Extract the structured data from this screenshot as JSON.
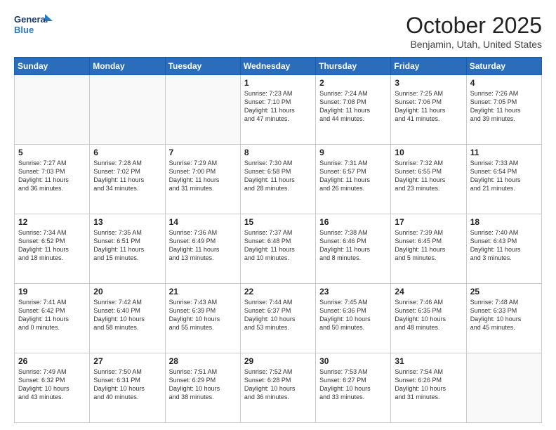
{
  "header": {
    "logo_line1": "General",
    "logo_line2": "Blue",
    "month": "October 2025",
    "location": "Benjamin, Utah, United States"
  },
  "weekdays": [
    "Sunday",
    "Monday",
    "Tuesday",
    "Wednesday",
    "Thursday",
    "Friday",
    "Saturday"
  ],
  "weeks": [
    [
      {
        "day": "",
        "info": ""
      },
      {
        "day": "",
        "info": ""
      },
      {
        "day": "",
        "info": ""
      },
      {
        "day": "1",
        "info": "Sunrise: 7:23 AM\nSunset: 7:10 PM\nDaylight: 11 hours\nand 47 minutes."
      },
      {
        "day": "2",
        "info": "Sunrise: 7:24 AM\nSunset: 7:08 PM\nDaylight: 11 hours\nand 44 minutes."
      },
      {
        "day": "3",
        "info": "Sunrise: 7:25 AM\nSunset: 7:06 PM\nDaylight: 11 hours\nand 41 minutes."
      },
      {
        "day": "4",
        "info": "Sunrise: 7:26 AM\nSunset: 7:05 PM\nDaylight: 11 hours\nand 39 minutes."
      }
    ],
    [
      {
        "day": "5",
        "info": "Sunrise: 7:27 AM\nSunset: 7:03 PM\nDaylight: 11 hours\nand 36 minutes."
      },
      {
        "day": "6",
        "info": "Sunrise: 7:28 AM\nSunset: 7:02 PM\nDaylight: 11 hours\nand 34 minutes."
      },
      {
        "day": "7",
        "info": "Sunrise: 7:29 AM\nSunset: 7:00 PM\nDaylight: 11 hours\nand 31 minutes."
      },
      {
        "day": "8",
        "info": "Sunrise: 7:30 AM\nSunset: 6:58 PM\nDaylight: 11 hours\nand 28 minutes."
      },
      {
        "day": "9",
        "info": "Sunrise: 7:31 AM\nSunset: 6:57 PM\nDaylight: 11 hours\nand 26 minutes."
      },
      {
        "day": "10",
        "info": "Sunrise: 7:32 AM\nSunset: 6:55 PM\nDaylight: 11 hours\nand 23 minutes."
      },
      {
        "day": "11",
        "info": "Sunrise: 7:33 AM\nSunset: 6:54 PM\nDaylight: 11 hours\nand 21 minutes."
      }
    ],
    [
      {
        "day": "12",
        "info": "Sunrise: 7:34 AM\nSunset: 6:52 PM\nDaylight: 11 hours\nand 18 minutes."
      },
      {
        "day": "13",
        "info": "Sunrise: 7:35 AM\nSunset: 6:51 PM\nDaylight: 11 hours\nand 15 minutes."
      },
      {
        "day": "14",
        "info": "Sunrise: 7:36 AM\nSunset: 6:49 PM\nDaylight: 11 hours\nand 13 minutes."
      },
      {
        "day": "15",
        "info": "Sunrise: 7:37 AM\nSunset: 6:48 PM\nDaylight: 11 hours\nand 10 minutes."
      },
      {
        "day": "16",
        "info": "Sunrise: 7:38 AM\nSunset: 6:46 PM\nDaylight: 11 hours\nand 8 minutes."
      },
      {
        "day": "17",
        "info": "Sunrise: 7:39 AM\nSunset: 6:45 PM\nDaylight: 11 hours\nand 5 minutes."
      },
      {
        "day": "18",
        "info": "Sunrise: 7:40 AM\nSunset: 6:43 PM\nDaylight: 11 hours\nand 3 minutes."
      }
    ],
    [
      {
        "day": "19",
        "info": "Sunrise: 7:41 AM\nSunset: 6:42 PM\nDaylight: 11 hours\nand 0 minutes."
      },
      {
        "day": "20",
        "info": "Sunrise: 7:42 AM\nSunset: 6:40 PM\nDaylight: 10 hours\nand 58 minutes."
      },
      {
        "day": "21",
        "info": "Sunrise: 7:43 AM\nSunset: 6:39 PM\nDaylight: 10 hours\nand 55 minutes."
      },
      {
        "day": "22",
        "info": "Sunrise: 7:44 AM\nSunset: 6:37 PM\nDaylight: 10 hours\nand 53 minutes."
      },
      {
        "day": "23",
        "info": "Sunrise: 7:45 AM\nSunset: 6:36 PM\nDaylight: 10 hours\nand 50 minutes."
      },
      {
        "day": "24",
        "info": "Sunrise: 7:46 AM\nSunset: 6:35 PM\nDaylight: 10 hours\nand 48 minutes."
      },
      {
        "day": "25",
        "info": "Sunrise: 7:48 AM\nSunset: 6:33 PM\nDaylight: 10 hours\nand 45 minutes."
      }
    ],
    [
      {
        "day": "26",
        "info": "Sunrise: 7:49 AM\nSunset: 6:32 PM\nDaylight: 10 hours\nand 43 minutes."
      },
      {
        "day": "27",
        "info": "Sunrise: 7:50 AM\nSunset: 6:31 PM\nDaylight: 10 hours\nand 40 minutes."
      },
      {
        "day": "28",
        "info": "Sunrise: 7:51 AM\nSunset: 6:29 PM\nDaylight: 10 hours\nand 38 minutes."
      },
      {
        "day": "29",
        "info": "Sunrise: 7:52 AM\nSunset: 6:28 PM\nDaylight: 10 hours\nand 36 minutes."
      },
      {
        "day": "30",
        "info": "Sunrise: 7:53 AM\nSunset: 6:27 PM\nDaylight: 10 hours\nand 33 minutes."
      },
      {
        "day": "31",
        "info": "Sunrise: 7:54 AM\nSunset: 6:26 PM\nDaylight: 10 hours\nand 31 minutes."
      },
      {
        "day": "",
        "info": ""
      }
    ]
  ]
}
